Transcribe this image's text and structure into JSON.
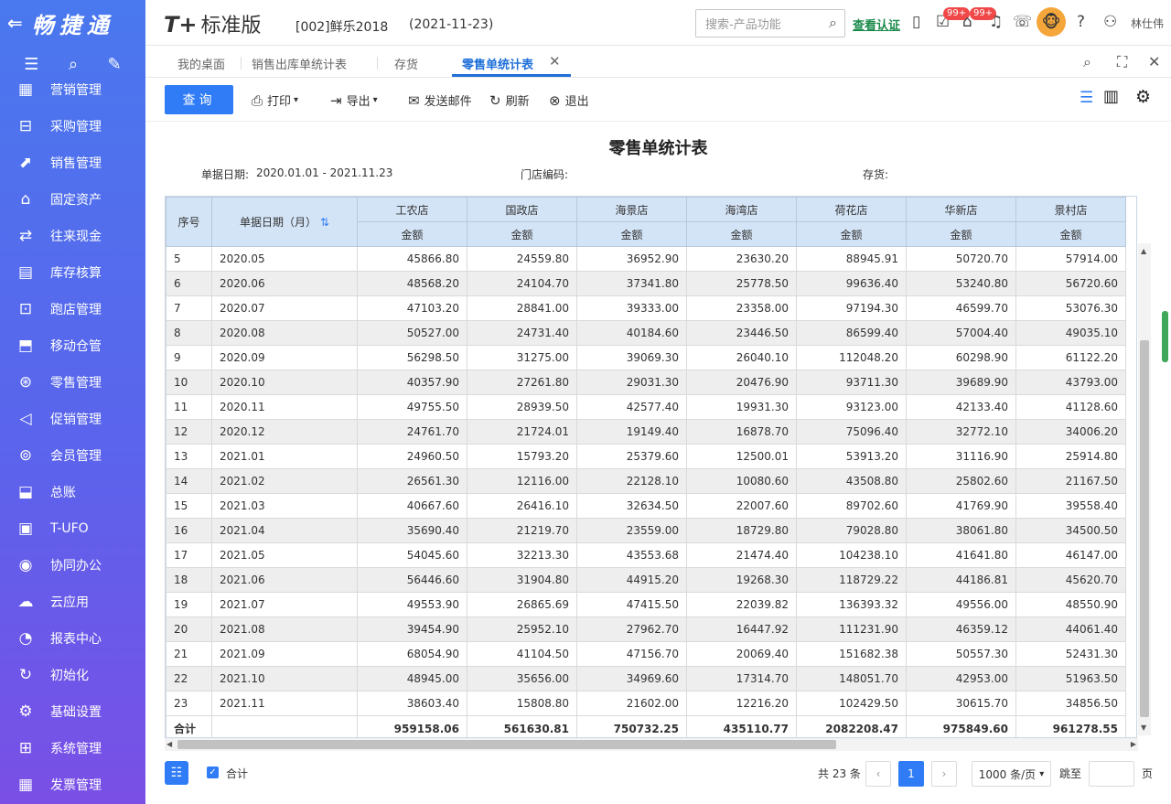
{
  "sidebar": {
    "brand": "畅捷通",
    "items": [
      {
        "label": "营销管理"
      },
      {
        "label": "采购管理"
      },
      {
        "label": "销售管理"
      },
      {
        "label": "固定资产"
      },
      {
        "label": "往来现金"
      },
      {
        "label": "库存核算"
      },
      {
        "label": "跑店管理"
      },
      {
        "label": "移动仓管"
      },
      {
        "label": "零售管理"
      },
      {
        "label": "促销管理"
      },
      {
        "label": "会员管理"
      },
      {
        "label": "总账"
      },
      {
        "label": "T-UFO"
      },
      {
        "label": "协同办公"
      },
      {
        "label": "云应用"
      },
      {
        "label": "报表中心"
      },
      {
        "label": "初始化"
      },
      {
        "label": "基础设置"
      },
      {
        "label": "系统管理"
      },
      {
        "label": "发票管理"
      }
    ]
  },
  "topbar": {
    "logo": "T+",
    "edition": "标准版",
    "account": "[002]鲜乐2018",
    "date": "(2021-11-23)",
    "search_placeholder": "搜索-产品功能",
    "verify": "查看认证",
    "badge1": "99+",
    "badge2": "99+",
    "user": "林仕伟"
  },
  "tabs": [
    {
      "label": "我的桌面"
    },
    {
      "label": "销售出库单统计表"
    },
    {
      "label": "存货"
    },
    {
      "label": "零售单统计表"
    }
  ],
  "toolbar": {
    "query": "查询",
    "print": "打印",
    "export": "导出",
    "mail": "发送邮件",
    "refresh": "刷新",
    "exit": "退出"
  },
  "report": {
    "title": "零售单统计表",
    "date_label": "单据日期:",
    "date_value": "2020.01.01 - 2021.11.23",
    "store_label": "门店编码:",
    "stock_label": "存货:"
  },
  "table": {
    "col_seq": "序号",
    "col_date": "单据日期（月）",
    "stores": [
      "工农店",
      "国政店",
      "海景店",
      "海湾店",
      "荷花店",
      "华新店",
      "景村店"
    ],
    "sub_label": "金额",
    "rows": [
      {
        "seq": "5",
        "date": "2020.05",
        "v": [
          "45866.80",
          "24559.80",
          "36952.90",
          "23630.20",
          "88945.91",
          "50720.70",
          "57914.00"
        ]
      },
      {
        "seq": "6",
        "date": "2020.06",
        "v": [
          "48568.20",
          "24104.70",
          "37341.80",
          "25778.50",
          "99636.40",
          "53240.80",
          "56720.60"
        ]
      },
      {
        "seq": "7",
        "date": "2020.07",
        "v": [
          "47103.20",
          "28841.00",
          "39333.00",
          "23358.00",
          "97194.30",
          "46599.70",
          "53076.30"
        ]
      },
      {
        "seq": "8",
        "date": "2020.08",
        "v": [
          "50527.00",
          "24731.40",
          "40184.60",
          "23446.50",
          "86599.40",
          "57004.40",
          "49035.10"
        ]
      },
      {
        "seq": "9",
        "date": "2020.09",
        "v": [
          "56298.50",
          "31275.00",
          "39069.30",
          "26040.10",
          "112048.20",
          "60298.90",
          "61122.20"
        ]
      },
      {
        "seq": "10",
        "date": "2020.10",
        "v": [
          "40357.90",
          "27261.80",
          "29031.30",
          "20476.90",
          "93711.30",
          "39689.90",
          "43793.00"
        ]
      },
      {
        "seq": "11",
        "date": "2020.11",
        "v": [
          "49755.50",
          "28939.50",
          "42577.40",
          "19931.30",
          "93123.00",
          "42133.40",
          "41128.60"
        ]
      },
      {
        "seq": "12",
        "date": "2020.12",
        "v": [
          "24761.70",
          "21724.01",
          "19149.40",
          "16878.70",
          "75096.40",
          "32772.10",
          "34006.20"
        ]
      },
      {
        "seq": "13",
        "date": "2021.01",
        "v": [
          "24960.50",
          "15793.20",
          "25379.60",
          "12500.01",
          "53913.20",
          "31116.90",
          "25914.80"
        ]
      },
      {
        "seq": "14",
        "date": "2021.02",
        "v": [
          "26561.30",
          "12116.00",
          "22128.10",
          "10080.60",
          "43508.80",
          "25802.60",
          "21167.50"
        ]
      },
      {
        "seq": "15",
        "date": "2021.03",
        "v": [
          "40667.60",
          "26416.10",
          "32634.50",
          "22007.60",
          "89702.60",
          "41769.90",
          "39558.40"
        ]
      },
      {
        "seq": "16",
        "date": "2021.04",
        "v": [
          "35690.40",
          "21219.70",
          "23559.00",
          "18729.80",
          "79028.80",
          "38061.80",
          "34500.50"
        ]
      },
      {
        "seq": "17",
        "date": "2021.05",
        "v": [
          "54045.60",
          "32213.30",
          "43553.68",
          "21474.40",
          "104238.10",
          "41641.80",
          "46147.00"
        ]
      },
      {
        "seq": "18",
        "date": "2021.06",
        "v": [
          "56446.60",
          "31904.80",
          "44915.20",
          "19268.30",
          "118729.22",
          "44186.81",
          "45620.70"
        ]
      },
      {
        "seq": "19",
        "date": "2021.07",
        "v": [
          "49553.90",
          "26865.69",
          "47415.50",
          "22039.82",
          "136393.32",
          "49556.00",
          "48550.90"
        ]
      },
      {
        "seq": "20",
        "date": "2021.08",
        "v": [
          "39454.90",
          "25952.10",
          "27962.70",
          "16447.92",
          "111231.90",
          "46359.12",
          "44061.40"
        ]
      },
      {
        "seq": "21",
        "date": "2021.09",
        "v": [
          "68054.90",
          "41104.50",
          "47156.70",
          "20069.40",
          "151682.38",
          "50557.30",
          "52431.30"
        ]
      },
      {
        "seq": "22",
        "date": "2021.10",
        "v": [
          "48945.00",
          "35656.00",
          "34969.60",
          "17314.70",
          "148051.70",
          "42953.00",
          "51963.50"
        ]
      },
      {
        "seq": "23",
        "date": "2021.11",
        "v": [
          "38603.40",
          "15808.80",
          "21602.00",
          "12216.20",
          "102429.50",
          "30615.70",
          "34856.50"
        ]
      }
    ],
    "total_label": "合计",
    "totals": [
      "959158.06",
      "561630.81",
      "750732.25",
      "435110.77",
      "2082208.47",
      "975849.60",
      "961278.55"
    ]
  },
  "footer": {
    "sum_label": "合计",
    "total_text": "共 23 条",
    "current_page": "1",
    "page_size": "1000 条/页",
    "jump_label": "跳至",
    "page_suffix": "页"
  }
}
